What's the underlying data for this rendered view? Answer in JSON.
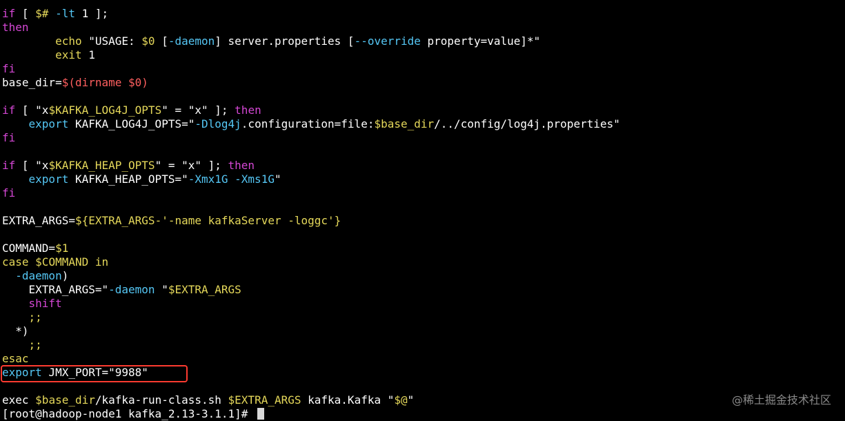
{
  "terminal": {
    "lines": [
      [
        [
          "if",
          "purple"
        ],
        [
          " [ ",
          "white"
        ],
        [
          "$#",
          "yellow"
        ],
        [
          " ",
          "white"
        ],
        [
          "-lt",
          "cyan"
        ],
        [
          " 1 ];",
          "white"
        ]
      ],
      [
        [
          "then",
          "purple"
        ]
      ],
      [
        [
          "        ",
          "white"
        ],
        [
          "echo",
          "yellow"
        ],
        [
          " \"USAGE: ",
          "white"
        ],
        [
          "$0",
          "yellow"
        ],
        [
          " [",
          "white"
        ],
        [
          "-daemon",
          "cyan"
        ],
        [
          "] server.properties [",
          "white"
        ],
        [
          "--override",
          "cyan"
        ],
        [
          " property=value]*\"",
          "white"
        ]
      ],
      [
        [
          "        ",
          "white"
        ],
        [
          "exit",
          "yellow"
        ],
        [
          " 1",
          "white"
        ]
      ],
      [
        [
          "fi",
          "purple"
        ]
      ],
      [
        [
          "base_dir=",
          "white"
        ],
        [
          "$(dirname $0)",
          "red"
        ]
      ],
      [],
      [
        [
          "if",
          "purple"
        ],
        [
          " [ \"x",
          "white"
        ],
        [
          "$KAFKA_LOG4J_OPTS",
          "yellow"
        ],
        [
          "\" = \"x\" ]; ",
          "white"
        ],
        [
          "then",
          "purple"
        ]
      ],
      [
        [
          "    ",
          "white"
        ],
        [
          "export",
          "cyan"
        ],
        [
          " KAFKA_LOG4J_OPTS=\"",
          "white"
        ],
        [
          "-Dlog4j",
          "cyan"
        ],
        [
          ".configuration=file:",
          "white"
        ],
        [
          "$base_dir",
          "yellow"
        ],
        [
          "/../config/log4j.properties\"",
          "white"
        ]
      ],
      [
        [
          "fi",
          "purple"
        ]
      ],
      [],
      [
        [
          "if",
          "purple"
        ],
        [
          " [ \"x",
          "white"
        ],
        [
          "$KAFKA_HEAP_OPTS",
          "yellow"
        ],
        [
          "\" = \"x\" ]; ",
          "white"
        ],
        [
          "then",
          "purple"
        ]
      ],
      [
        [
          "    ",
          "white"
        ],
        [
          "export",
          "cyan"
        ],
        [
          " KAFKA_HEAP_OPTS=\"",
          "white"
        ],
        [
          "-Xmx1G",
          "cyan"
        ],
        [
          " ",
          "white"
        ],
        [
          "-Xms1G",
          "cyan"
        ],
        [
          "\"",
          "white"
        ]
      ],
      [
        [
          "fi",
          "purple"
        ]
      ],
      [],
      [
        [
          "EXTRA_ARGS=",
          "white"
        ],
        [
          "${EXTRA_ARGS-'-name kafkaServer -loggc'}",
          "yellow"
        ]
      ],
      [],
      [
        [
          "COMMAND=",
          "white"
        ],
        [
          "$1",
          "yellow"
        ]
      ],
      [
        [
          "case",
          "yellow"
        ],
        [
          " ",
          "white"
        ],
        [
          "$COMMAND",
          "yellow"
        ],
        [
          " ",
          "white"
        ],
        [
          "in",
          "yellow"
        ]
      ],
      [
        [
          "  ",
          "white"
        ],
        [
          "-daemon",
          "cyan"
        ],
        [
          ")",
          "white"
        ]
      ],
      [
        [
          "    EXTRA_ARGS=\"",
          "white"
        ],
        [
          "-daemon",
          "cyan"
        ],
        [
          " \"",
          "white"
        ],
        [
          "$EXTRA_ARGS",
          "yellow"
        ]
      ],
      [
        [
          "    ",
          "white"
        ],
        [
          "shift",
          "purple"
        ]
      ],
      [
        [
          "    ",
          "white"
        ],
        [
          ";;",
          "yellow"
        ]
      ],
      [
        [
          "  *)",
          "white"
        ]
      ],
      [
        [
          "    ",
          "white"
        ],
        [
          ";;",
          "yellow"
        ]
      ],
      [
        [
          "esac",
          "yellow"
        ]
      ],
      [
        [
          "export",
          "cyan"
        ],
        [
          " JMX_PORT=\"9988\"",
          "white"
        ]
      ],
      [],
      [
        [
          "exec ",
          "white"
        ],
        [
          "$base_dir",
          "yellow"
        ],
        [
          "/kafka-run-class.sh ",
          "white"
        ],
        [
          "$EXTRA_ARGS",
          "yellow"
        ],
        [
          " kafka.Kafka \"",
          "white"
        ],
        [
          "$@",
          "yellow"
        ],
        [
          "\"",
          "white"
        ]
      ],
      [
        [
          "[root@hadoop-node1 kafka_2.13-3.1.1]# ",
          "white"
        ]
      ]
    ],
    "cursor_line": 29
  },
  "colors": {
    "white": "#ffffff",
    "purple": "#d447d4",
    "yellow": "#e5d85a",
    "cyan": "#55c7f5",
    "red": "#ff5f5f",
    "highlight": "#ff3b30"
  },
  "watermark": "@稀土掘金技术社区"
}
